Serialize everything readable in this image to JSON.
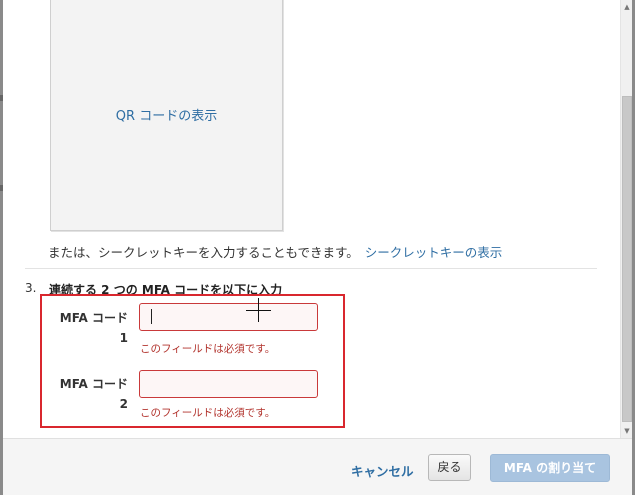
{
  "qr": {
    "show_link": "QR コードの表示"
  },
  "secret": {
    "text": "または、シークレットキーを入力することもできます。",
    "link": "シークレットキーの表示"
  },
  "step": {
    "number": "3.",
    "title": "連続する 2 つの MFA コードを以下に入力"
  },
  "fields": [
    {
      "label_line1": "MFA コード",
      "label_line2": "1",
      "value": "",
      "error": "このフィールドは必須です。"
    },
    {
      "label_line1": "MFA コード",
      "label_line2": "2",
      "value": "",
      "error": "このフィールドは必須です。"
    }
  ],
  "footer": {
    "cancel_label": "キャンセル",
    "back_label": "戻る",
    "assign_label": "MFA の割り当て"
  },
  "colors": {
    "link": "#2f6ea3",
    "error": "#b2332d",
    "highlight_border": "#d9272e",
    "primary_disabled": "#a9c4e0"
  }
}
